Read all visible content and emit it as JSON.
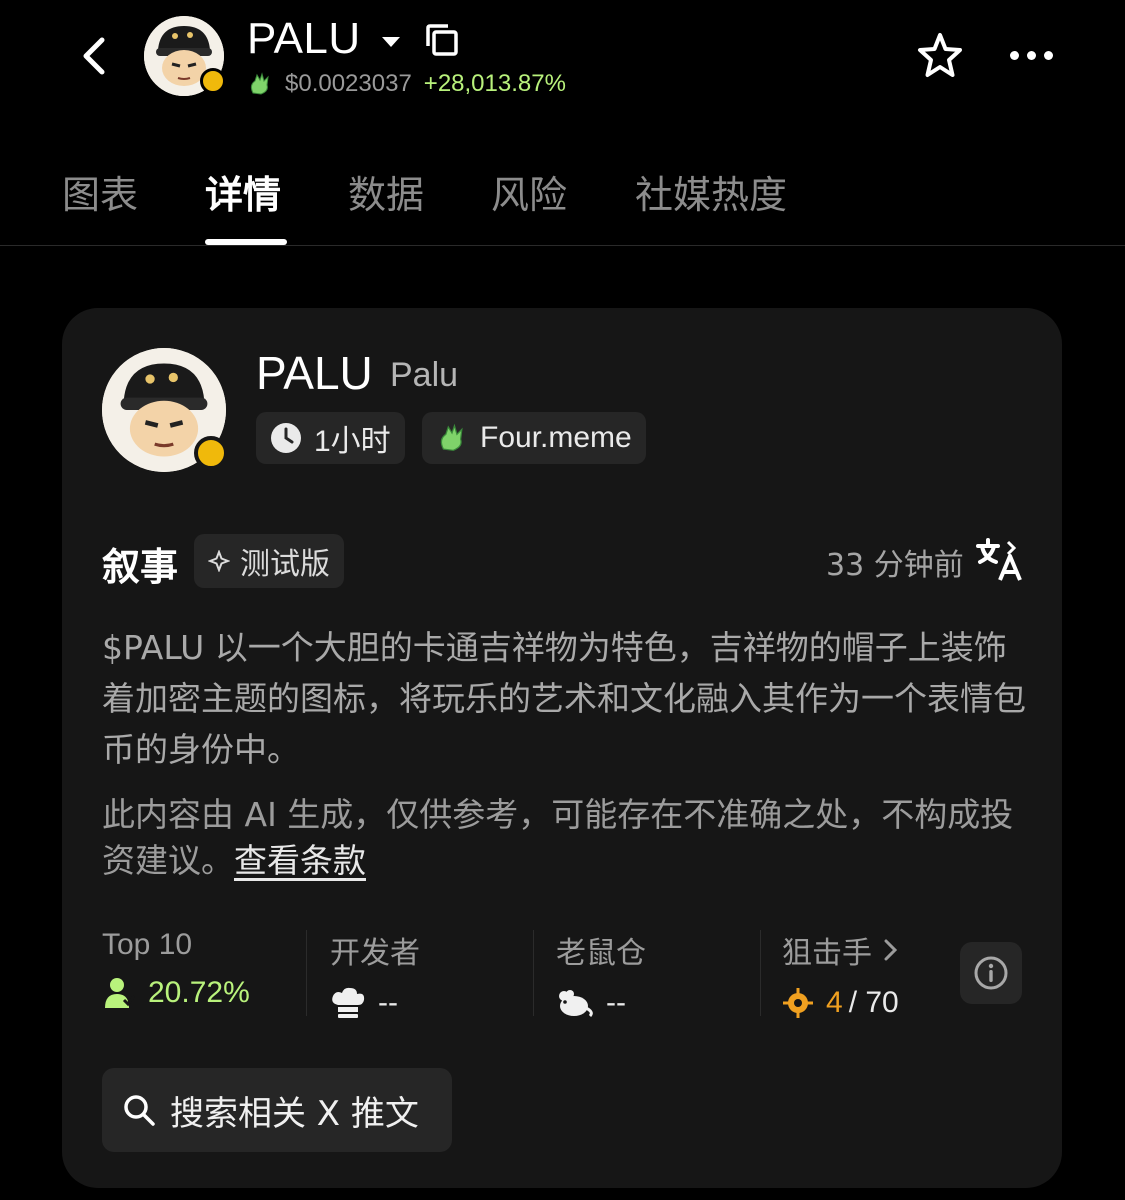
{
  "header": {
    "title": "PALU",
    "price": "$0.0023037",
    "change": "+28,013.87%"
  },
  "tabs": [
    {
      "label": "图表",
      "active": false
    },
    {
      "label": "详情",
      "active": true
    },
    {
      "label": "数据",
      "active": false
    },
    {
      "label": "风险",
      "active": false
    },
    {
      "label": "社媒热度",
      "active": false
    }
  ],
  "card": {
    "symbol": "PALU",
    "name": "Palu",
    "age": "1小时",
    "platform": "Four.meme",
    "section_title": "叙事",
    "beta_label": "测试版",
    "updated": "33 分钟前",
    "description": "$PALU 以一个大胆的卡通吉祥物为特色，吉祥物的帽子上装饰着加密主题的图标，将玩乐的艺术和文化融入其作为一个表情包币的身份中。",
    "disclaimer": "此内容由 AI 生成，仅供参考，可能存在不准确之处，不构成投资建议。",
    "terms_link": "查看条款",
    "stats": {
      "top10_label": "Top 10",
      "top10_value": "20.72%",
      "dev_label": "开发者",
      "dev_value": "--",
      "rat_label": "老鼠仓",
      "rat_value": "--",
      "sniper_label": "狙击手",
      "sniper_count": "4",
      "sniper_total": "/ 70"
    },
    "search_label": "搜索相关 X 推文"
  },
  "colors": {
    "positive": "#b9f27c",
    "sniper": "#f0a020",
    "bnb_badge": "#f0b90b"
  }
}
